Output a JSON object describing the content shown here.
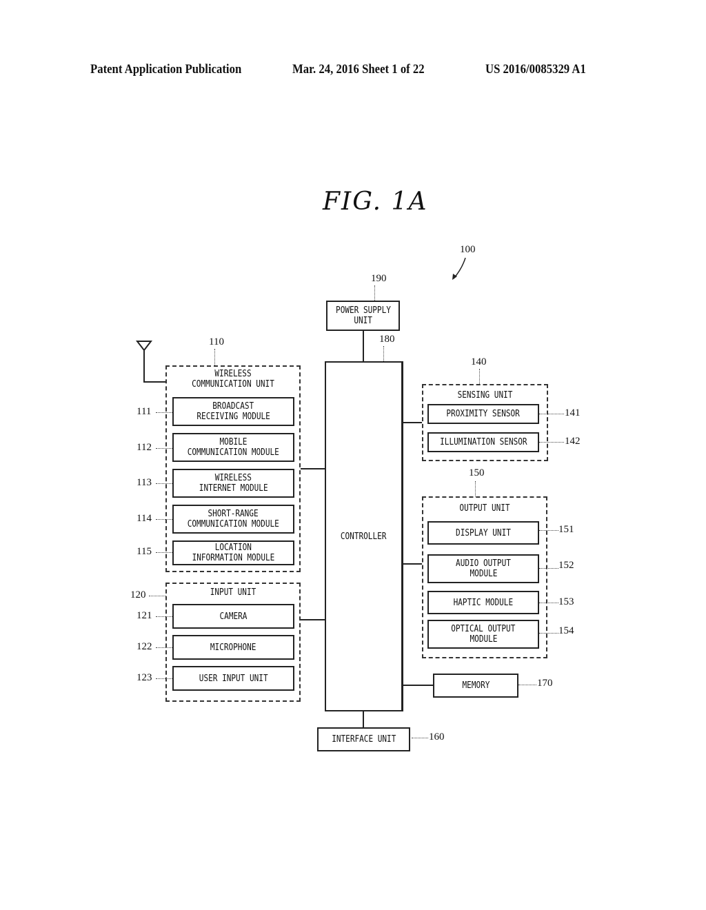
{
  "header": {
    "publication": "Patent Application Publication",
    "date_sheet": "Mar. 24, 2016  Sheet 1 of 22",
    "number": "US 2016/0085329 A1"
  },
  "figure": {
    "title": "FIG.  1A",
    "ref": "100"
  },
  "blocks": {
    "power_supply": {
      "ref": "190",
      "line1": "POWER SUPPLY",
      "line2": "UNIT"
    },
    "controller": {
      "ref": "180",
      "label": "CONTROLLER"
    },
    "wireless": {
      "ref": "110",
      "title1": "WIRELESS",
      "title2": "COMMUNICATION UNIT",
      "modules": [
        {
          "ref": "111",
          "line1": "BROADCAST",
          "line2": "RECEIVING MODULE"
        },
        {
          "ref": "112",
          "line1": "MOBILE",
          "line2": "COMMUNICATION MODULE"
        },
        {
          "ref": "113",
          "line1": "WIRELESS",
          "line2": "INTERNET MODULE"
        },
        {
          "ref": "114",
          "line1": "SHORT-RANGE",
          "line2": "COMMUNICATION MODULE"
        },
        {
          "ref": "115",
          "line1": "LOCATION",
          "line2": "INFORMATION MODULE"
        }
      ]
    },
    "input": {
      "ref": "120",
      "title": "INPUT UNIT",
      "modules": [
        {
          "ref": "121",
          "label": "CAMERA"
        },
        {
          "ref": "122",
          "label": "MICROPHONE"
        },
        {
          "ref": "123",
          "label": "USER INPUT UNIT"
        }
      ]
    },
    "sensing": {
      "ref": "140",
      "title": "SENSING UNIT",
      "modules": [
        {
          "ref": "141",
          "label": "PROXIMITY SENSOR"
        },
        {
          "ref": "142",
          "label": "ILLUMINATION SENSOR"
        }
      ]
    },
    "output": {
      "ref": "150",
      "title": "OUTPUT UNIT",
      "modules": [
        {
          "ref": "151",
          "line1": "DISPLAY UNIT",
          "line2": ""
        },
        {
          "ref": "152",
          "line1": "AUDIO OUTPUT",
          "line2": "MODULE"
        },
        {
          "ref": "153",
          "line1": "HAPTIC MODULE",
          "line2": ""
        },
        {
          "ref": "154",
          "line1": "OPTICAL OUTPUT",
          "line2": "MODULE"
        }
      ]
    },
    "memory": {
      "ref": "170",
      "label": "MEMORY"
    },
    "interface": {
      "ref": "160",
      "label": "INTERFACE UNIT"
    }
  }
}
